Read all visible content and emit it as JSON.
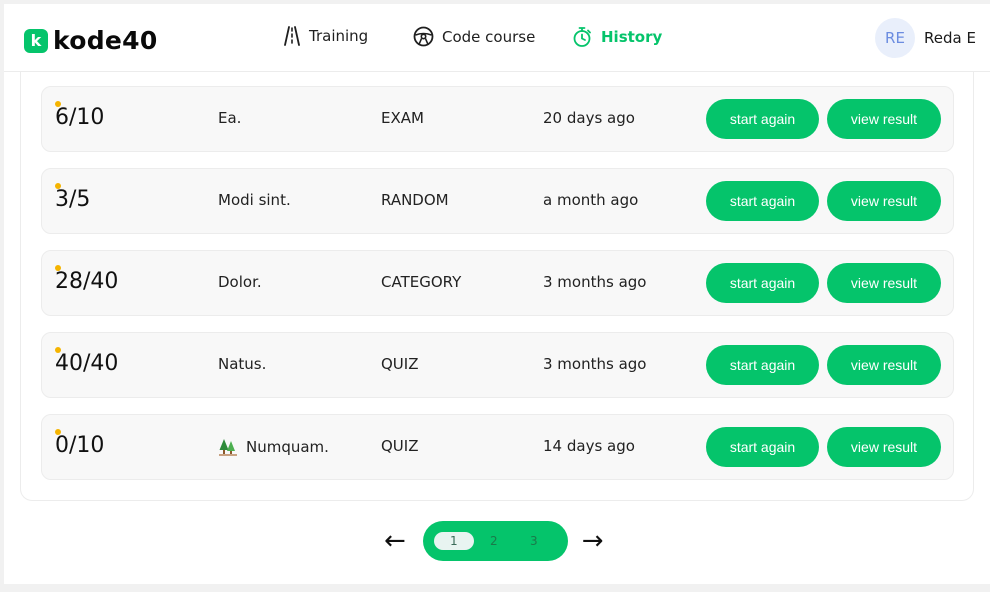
{
  "brand": {
    "badge": "k",
    "name": "kode40"
  },
  "nav": [
    {
      "label": "Training",
      "icon": "road-icon"
    },
    {
      "label": "Code course",
      "icon": "steering-wheel-icon"
    },
    {
      "label": "History",
      "icon": "stopwatch-icon",
      "active": true
    }
  ],
  "user": {
    "initials": "RE",
    "name": "Reda E"
  },
  "history": [
    {
      "score": "6/10",
      "title": "Ea.",
      "type": "EXAM",
      "time": "20 days ago",
      "start_label": "start again",
      "view_label": "view result"
    },
    {
      "score": "3/5",
      "title": "Modi sint.",
      "type": "RANDOM",
      "time": "a month ago",
      "start_label": "start again",
      "view_label": "view result"
    },
    {
      "score": "28/40",
      "title": "Dolor.",
      "type": "CATEGORY",
      "time": "3 months ago",
      "start_label": "start again",
      "view_label": "view result"
    },
    {
      "score": "40/40",
      "title": "Natus.",
      "type": "QUIZ",
      "time": "3 months ago",
      "start_label": "start again",
      "view_label": "view result"
    },
    {
      "score": "0/10",
      "title": "Numquam.",
      "type": "QUIZ",
      "time": "14 days ago",
      "start_label": "start again",
      "view_label": "view result",
      "icon": "tree-icon"
    }
  ],
  "pagination": {
    "prev": "←",
    "next": "→",
    "pages": [
      "1",
      "2",
      "3"
    ],
    "current": "1"
  },
  "colors": {
    "accent": "#05c46b",
    "dot": "#f5b400",
    "avatar_bg": "#e9effb"
  }
}
